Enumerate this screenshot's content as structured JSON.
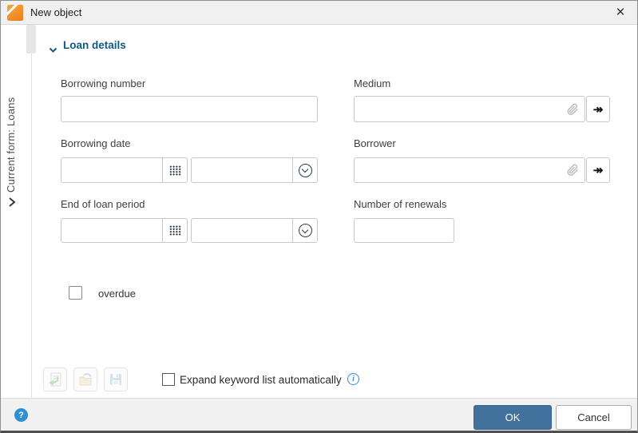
{
  "window": {
    "title": "New object"
  },
  "titlebar": {
    "close_icon": "×"
  },
  "sidebar": {
    "current_form_label": "Current form: Loans"
  },
  "section": {
    "title": "Loan details"
  },
  "fields": {
    "borrowing_number": {
      "label": "Borrowing number",
      "value": ""
    },
    "medium": {
      "label": "Medium",
      "value": ""
    },
    "borrowing_date": {
      "label": "Borrowing date",
      "date": "",
      "time": ""
    },
    "borrower": {
      "label": "Borrower",
      "value": ""
    },
    "end_of_loan_period": {
      "label": "End of loan period",
      "date": "",
      "time": ""
    },
    "number_of_renewals": {
      "label": "Number of renewals",
      "value": ""
    },
    "overdue": {
      "label": "overdue",
      "checked": false
    }
  },
  "keyword_option": {
    "label": "Expand keyword list automatically",
    "checked": false
  },
  "toolbar": {
    "icons": [
      "apply-keyword-form",
      "open-folder",
      "save-keywords"
    ]
  },
  "footer": {
    "ok": "OK",
    "cancel": "Cancel"
  },
  "icons": {
    "goto_arrow": "↠",
    "help": "?",
    "info": "i"
  },
  "colors": {
    "ok_button": "#41719c",
    "section_title": "#0f5a82",
    "info_blue": "#2e8fd4",
    "logo_orange": "#ee7c17",
    "titlebar_bg": "#f0f0f0",
    "footer_bg": "#f1f1f1"
  }
}
